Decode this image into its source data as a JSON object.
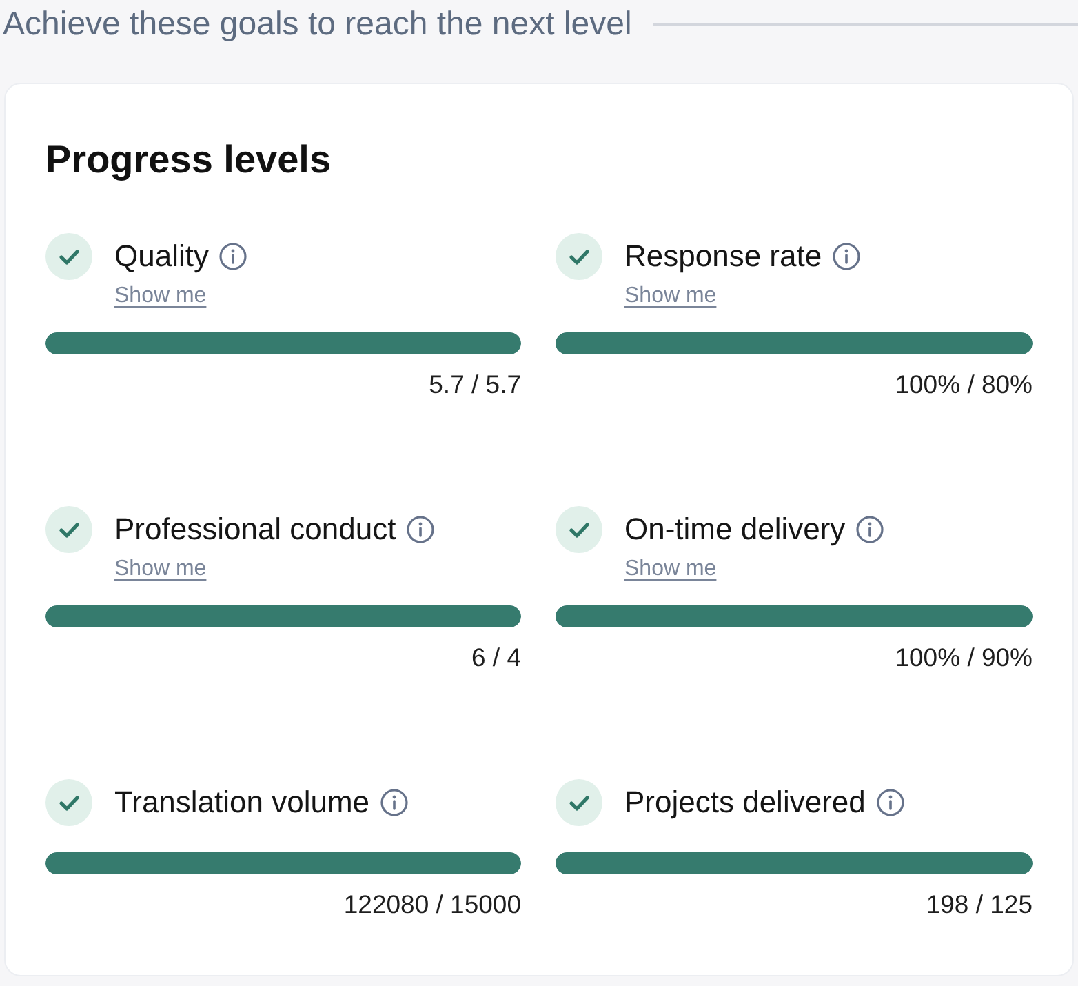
{
  "header": {
    "title": "Achieve these goals to reach the next level"
  },
  "card": {
    "title": "Progress levels",
    "goals": [
      {
        "name": "Quality",
        "achieved": true,
        "link": "Show me",
        "level": 1,
        "reading": "5.7 / 5.7"
      },
      {
        "name": "Response rate",
        "achieved": true,
        "link": "Show me",
        "level": 1,
        "reading": "100% / 80%"
      },
      {
        "name": "Professional conduct",
        "achieved": true,
        "link": "Show me",
        "level": 1,
        "reading": "6 / 4"
      },
      {
        "name": "On-time delivery",
        "achieved": true,
        "link": "Show me",
        "level": 1,
        "reading": "100% / 90%"
      },
      {
        "name": "Translation volume",
        "achieved": true,
        "level": 1,
        "reading": "122080 / 15000"
      },
      {
        "name": "Projects delivered",
        "achieved": true,
        "level": 1,
        "reading": "198 / 125"
      }
    ]
  }
}
